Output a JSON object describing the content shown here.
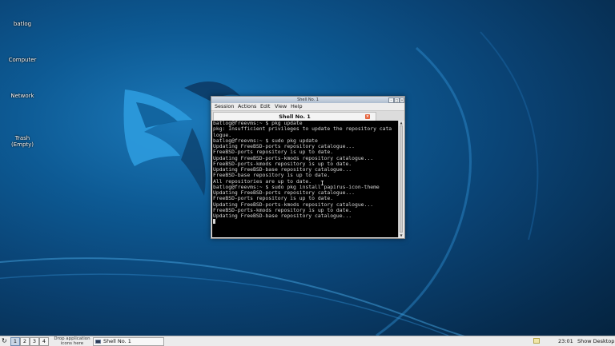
{
  "desktop": {
    "icons": [
      {
        "label": "batlog"
      },
      {
        "label": "Computer"
      },
      {
        "label": "Network"
      },
      {
        "label": "Trash\n(Empty)"
      }
    ]
  },
  "window": {
    "title": "Shell No. 1",
    "menu": [
      "Session",
      "Actions",
      "Edit",
      "View",
      "Help"
    ],
    "tab_label": "Shell No. 1",
    "terminal_lines": [
      "batlog@freevms:~ $ pkg update",
      "pkg: Insufficient privileges to update the repository cata",
      "logue.",
      "batlog@freevms:~ $ sudo pkg update",
      "Updating FreeBSD-ports repository catalogue...",
      "FreeBSD-ports repository is up to date.",
      "Updating FreeBSD-ports-kmods repository catalogue...",
      "FreeBSD-ports-kmods repository is up to date.",
      "Updating FreeBSD-base repository catalogue...",
      "FreeBSD-base repository is up to date.",
      "All repositories are up to date.",
      "batlog@freevms:~ $ sudo pkg install papirus-icon-theme",
      "Updating FreeBSD-ports repository catalogue...",
      "FreeBSD-ports repository is up to date.",
      "Updating FreeBSD-ports-kmods repository catalogue...",
      "FreeBSD-ports-kmods repository is up to date.",
      "Updating FreeBSD-base repository catalogue..."
    ]
  },
  "taskbar": {
    "workspaces": [
      "1",
      "2",
      "3",
      "4"
    ],
    "drop_label": "Drop application\nicons here",
    "task_label": "Shell No. 1",
    "clock": "23:01",
    "show_desktop": "Show Desktop"
  },
  "colors": {
    "accent": "#c9d6e6",
    "terminal_bg": "#000000",
    "terminal_fg": "#d6d6d6",
    "close_button": "#e5623b"
  }
}
